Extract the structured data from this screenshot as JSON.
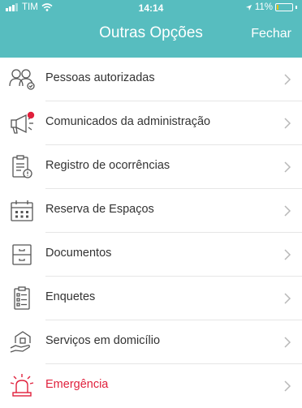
{
  "status_bar": {
    "carrier": "TIM",
    "time": "14:14",
    "battery_percent": "11%",
    "battery_level": 0.11,
    "icons": [
      "signal-bars-icon",
      "wifi-icon",
      "location-arrow-icon",
      "battery-icon"
    ]
  },
  "nav": {
    "title": "Outras Opções",
    "close_label": "Fechar"
  },
  "colors": {
    "header_bg": "#57bdbf",
    "text": "#333333",
    "icon": "#555555",
    "alert": "#e0203c"
  },
  "menu": {
    "items": [
      {
        "label": "Pessoas autorizadas",
        "icon": "people-icon"
      },
      {
        "label": "Comunicados da administração",
        "icon": "megaphone-icon",
        "badge": true
      },
      {
        "label": "Registro de ocorrências",
        "icon": "clipboard-alert-icon"
      },
      {
        "label": "Reserva de Espaços",
        "icon": "calendar-icon"
      },
      {
        "label": "Documentos",
        "icon": "file-cabinet-icon"
      },
      {
        "label": "Enquetes",
        "icon": "checklist-icon"
      },
      {
        "label": "Serviços em domicílio",
        "icon": "home-service-icon"
      },
      {
        "label": "Emergência",
        "icon": "siren-icon",
        "alert": true
      }
    ]
  }
}
